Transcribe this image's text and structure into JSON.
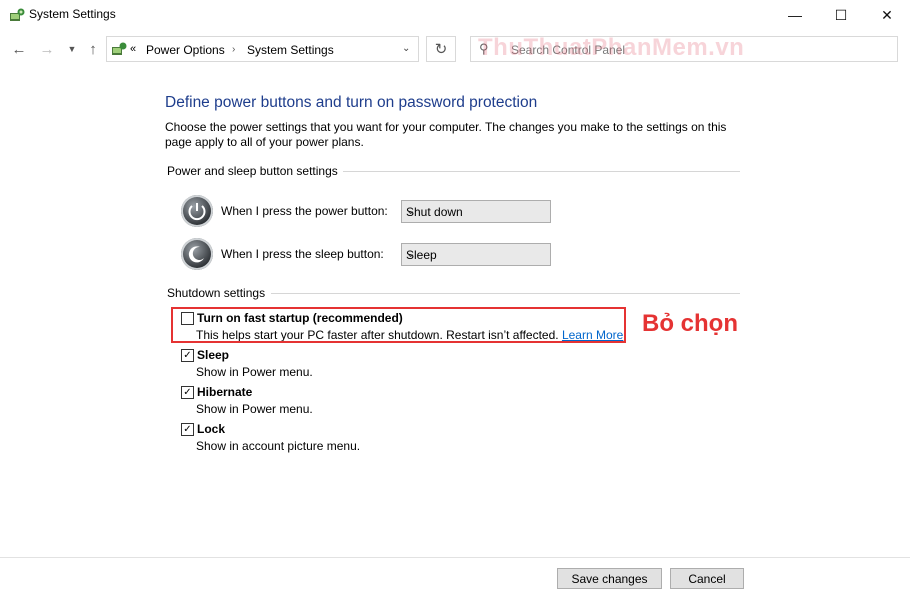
{
  "window": {
    "title": "System Settings"
  },
  "nav": {
    "breadcrumb_prefix": "«",
    "breadcrumb": [
      "Power Options",
      "System Settings"
    ],
    "search_placeholder": "Search Control Panel"
  },
  "watermark": "ThuThuatPhanMem.vn",
  "content": {
    "heading": "Define power buttons and turn on password protection",
    "description": "Choose the power settings that you want for your computer. The changes you make to the settings on this page apply to all of your power plans.",
    "power_sleep_section": "Power and sleep button settings",
    "power_button_label": "When I press the power button:",
    "power_button_value": "Shut down",
    "sleep_button_label": "When I press the sleep button:",
    "sleep_button_value": "Sleep",
    "shutdown_section": "Shutdown settings",
    "options": [
      {
        "label": "Turn on fast startup (recommended)",
        "desc": "This helps start your PC faster after shutdown. Restart isn’t affected.",
        "link": "Learn More",
        "checked": false
      },
      {
        "label": "Sleep",
        "desc": "Show in Power menu.",
        "checked": true
      },
      {
        "label": "Hibernate",
        "desc": "Show in Power menu.",
        "checked": true
      },
      {
        "label": "Lock",
        "desc": "Show in account picture menu.",
        "checked": true
      }
    ]
  },
  "annotation": "Bỏ chọn",
  "buttons": {
    "save": "Save changes",
    "cancel": "Cancel"
  },
  "colors": {
    "heading": "#1e3d8c",
    "annotation": "#e53333",
    "link": "#0066cc"
  }
}
